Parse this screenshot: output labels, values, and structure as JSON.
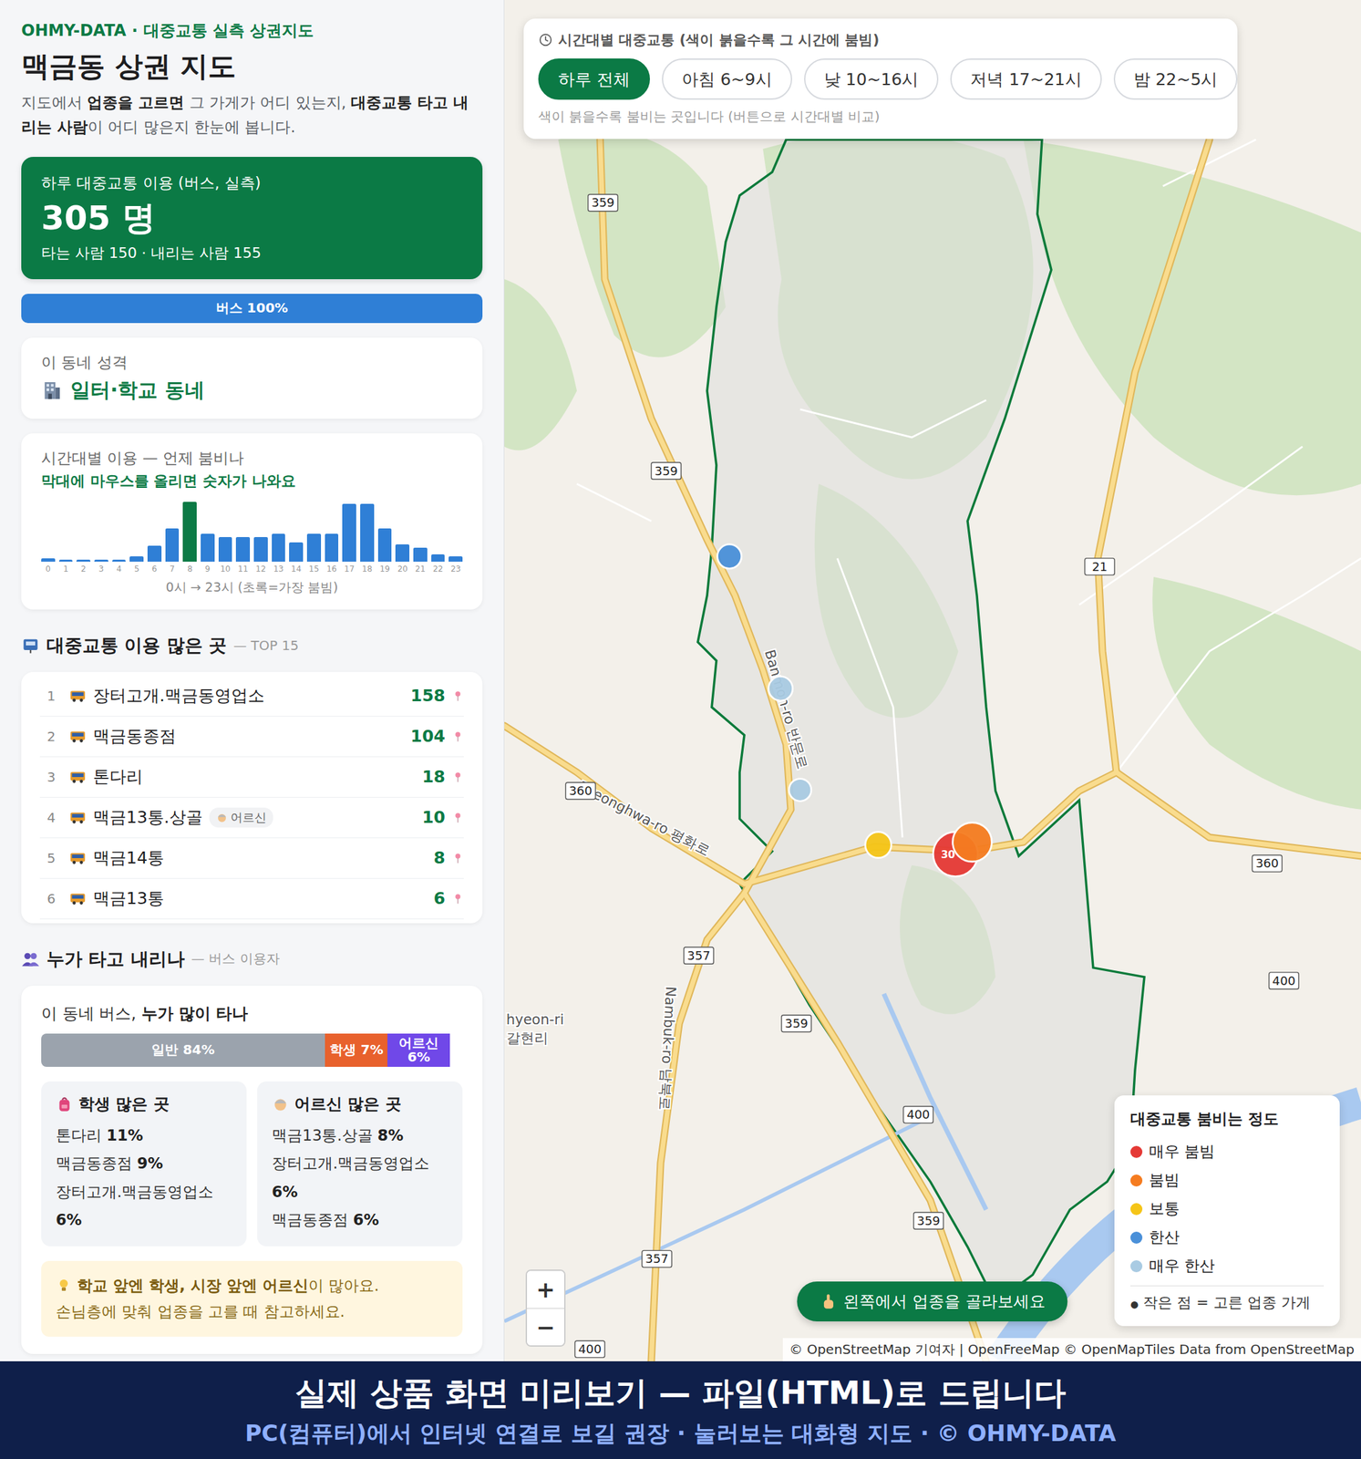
{
  "brand": "OHMY-DATA · 대중교통 실측 상권지도",
  "title": "맥금동 상권 지도",
  "intro": [
    {
      "text": "지도에서 ",
      "bold": false
    },
    {
      "text": "업종을 고르면",
      "bold": true
    },
    {
      "text": " 그 가게가 어디 있는지, ",
      "bold": false
    },
    {
      "text": "대중교통 타고 내리는 사람",
      "bold": true
    },
    {
      "text": "이 어디 많은지 한눈에 봅니다.",
      "bold": false
    }
  ],
  "summary": {
    "label": "하루 대중교통 이용 (버스, 실측)",
    "value": "305 명",
    "sub": "타는 사람 150 · 내리는 사람 155"
  },
  "mode_bar": {
    "label": "버스 100%",
    "level": 1
  },
  "character": {
    "label": "이 동네 성격",
    "value": "일터·학교 동네"
  },
  "hourly": {
    "title": "시간대별 이용 — 언제 붐비나",
    "hint": "막대에 마우스를 올리면 숫자가 나와요",
    "values": [
      2,
      1,
      1,
      1,
      1,
      3,
      9,
      19,
      34,
      16,
      14,
      14,
      14,
      16,
      11,
      16,
      16,
      33,
      33,
      19,
      10,
      8,
      4,
      3
    ],
    "ticks": [
      "0",
      "1",
      "2",
      "3",
      "4",
      "5",
      "6",
      "7",
      "8",
      "9",
      "10",
      "11",
      "12",
      "13",
      "14",
      "15",
      "16",
      "17",
      "18",
      "19",
      "20",
      "21",
      "22",
      "23"
    ],
    "axis": "0시 → 23시 (초록=가장 붐빔)"
  },
  "top_section": {
    "title": "대중교통 이용 많은 곳",
    "suffix": "— TOP 15"
  },
  "top_stops": [
    {
      "rank": "1",
      "name": "장터고개.맥금동영업소",
      "count": "158",
      "badge": null
    },
    {
      "rank": "2",
      "name": "맥금동종점",
      "count": "104",
      "badge": null
    },
    {
      "rank": "3",
      "name": "톤다리",
      "count": "18",
      "badge": null
    },
    {
      "rank": "4",
      "name": "맥금13통.상골",
      "count": "10",
      "badge": "어르신"
    },
    {
      "rank": "5",
      "name": "맥금14통",
      "count": "8",
      "badge": null
    },
    {
      "rank": "6",
      "name": "맥금13통",
      "count": "6",
      "badge": null
    }
  ],
  "who_section": {
    "title": "누가 타고 내리나",
    "suffix": "— 버스 이용자"
  },
  "riders": {
    "title_plain": "이 동네 버스, ",
    "title_bold": "누가 많이 타나",
    "segments": [
      {
        "label": "일반 84%",
        "level": 0.84,
        "color": "#9ba3ad"
      },
      {
        "label": "학생 7%",
        "level": 0.07,
        "color": "#e8612c"
      },
      {
        "label": "어르신 6%",
        "level": 0.06,
        "color": "#7048e8"
      }
    ]
  },
  "student_places": {
    "title": "학생 많은 곳",
    "items": [
      {
        "name": "톤다리",
        "pct": "11%"
      },
      {
        "name": "맥금동종점",
        "pct": "9%"
      },
      {
        "name": "장터고개.맥금동영업소",
        "pct": "6%"
      }
    ]
  },
  "elder_places": {
    "title": "어르신 많은 곳",
    "items": [
      {
        "name": "맥금13통.상골",
        "pct": "8%"
      },
      {
        "name": "장터고개.맥금동영업소",
        "pct": "6%"
      },
      {
        "name": "맥금동종점",
        "pct": "6%"
      }
    ]
  },
  "tip": {
    "line1": [
      {
        "text": "학교 앞엔 학생, 시장 앞엔 어르신",
        "bold": true
      },
      {
        "text": "이 많아요.",
        "bold": false
      }
    ],
    "line2": "손님층에 맞춰 업종을 고를 때 참고하세요."
  },
  "time_panel": {
    "title": "시간대별 대중교통 (색이 붉을수록 그 시간에 붐빔)",
    "buttons": [
      {
        "label": "하루 전체",
        "selected": true
      },
      {
        "label": "아침 6~9시",
        "selected": false
      },
      {
        "label": "낮 10~16시",
        "selected": false
      },
      {
        "label": "저녁 17~21시",
        "selected": false
      },
      {
        "label": "밤 22~5시",
        "selected": false
      }
    ],
    "hint": "색이 붉을수록 붐비는 곳입니다 (버튼으로 시간대별 비교)"
  },
  "map": {
    "shields": [
      {
        "text": "359"
      },
      {
        "text": "359"
      },
      {
        "text": "359"
      },
      {
        "text": "359"
      },
      {
        "text": "360"
      },
      {
        "text": "360"
      },
      {
        "text": "21"
      },
      {
        "text": "357"
      },
      {
        "text": "357"
      },
      {
        "text": "400"
      },
      {
        "text": "400"
      },
      {
        "text": "400"
      }
    ],
    "streets": [
      {
        "text": "Pyeonghwa-ro 평화로"
      },
      {
        "text": "Banmon-ro 반문로"
      },
      {
        "text": "Nambuk-ro 남북로"
      },
      {
        "text": "hyeon-ri"
      },
      {
        "text": "갈현리"
      }
    ],
    "markers": [
      {
        "color": "#4a90d9",
        "label": null
      },
      {
        "color": "#a9cbe3",
        "label": null
      },
      {
        "color": "#a9cbe3",
        "label": null
      },
      {
        "color": "#f5c518",
        "label": null
      },
      {
        "color": "#e53935",
        "label": "30"
      },
      {
        "color": "#f57c20",
        "label": null
      }
    ]
  },
  "legend": {
    "title": "대중교통 붐비는 정도",
    "items": [
      {
        "label": "매우 붐빔",
        "color": "#e53935"
      },
      {
        "label": "붐빔",
        "color": "#f57c20"
      },
      {
        "label": "보통",
        "color": "#f5c518"
      },
      {
        "label": "한산",
        "color": "#4a90d9"
      },
      {
        "label": "매우 한산",
        "color": "#a9cbe3"
      }
    ],
    "footer_mark": "●",
    "footer": "작은 점 = 고른 업종 가게"
  },
  "zoom": [
    "+",
    "−"
  ],
  "toast": "왼쪽에서 업종을 골라보세요",
  "attribution": "© OpenStreetMap 기여자 | OpenFreeMap © OpenMapTiles Data from OpenStreetMap",
  "banner": {
    "title": "실제 상품 화면 미리보기 — 파일(HTML)로 드립니다",
    "sub": "PC(컴퓨터)에서 인터넷 연결로 보길 권장 · 눌러보는 대화형 지도 · © OHMY-DATA"
  }
}
